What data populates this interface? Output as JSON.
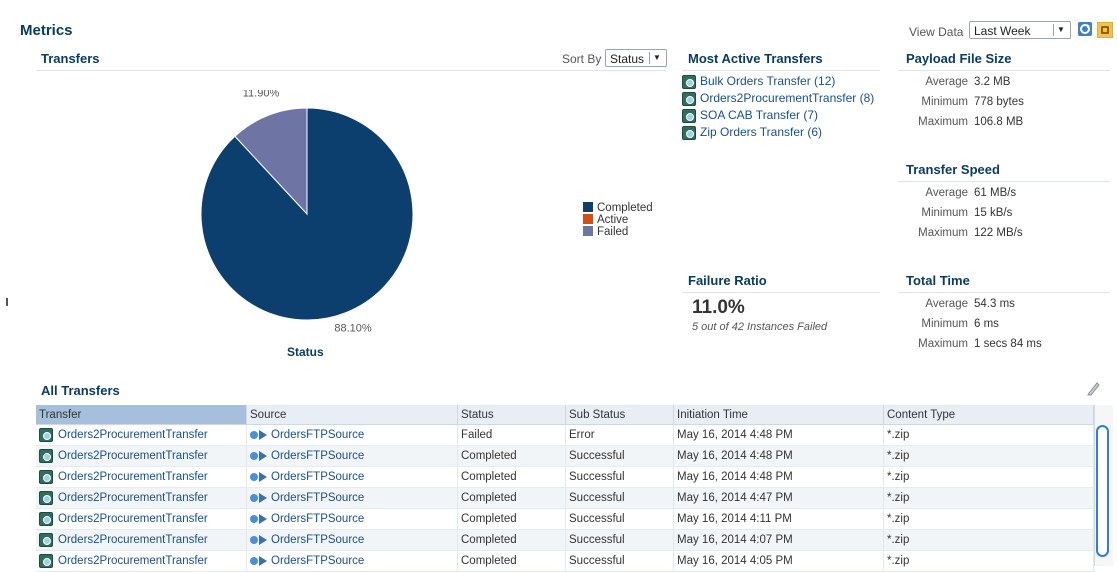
{
  "header": {
    "title": "Metrics",
    "view_data_label": "View Data",
    "view_data_value": "Last Week"
  },
  "transfers": {
    "title": "Transfers",
    "sort_by_label": "Sort By",
    "sort_by_value": "Status",
    "chart_data": {
      "type": "pie",
      "xlabel": "Status",
      "categories": [
        "Completed",
        "Active",
        "Failed"
      ],
      "values": [
        88.1,
        0,
        11.9
      ],
      "data_labels": [
        "88.10%",
        "",
        "11.90%"
      ],
      "legend_position": "right",
      "colors": [
        "#0d3f6e",
        "#d54e16",
        "#6e74a4"
      ]
    }
  },
  "most_active": {
    "title": "Most Active Transfers",
    "items": [
      "Bulk Orders Transfer (12)",
      "Orders2ProcurementTransfer (8)",
      "SOA CAB Transfer (7)",
      "Zip Orders Transfer (6)"
    ]
  },
  "payload": {
    "title": "Payload File Size",
    "rows": [
      {
        "k": "Average",
        "v": "3.2 MB"
      },
      {
        "k": "Minimum",
        "v": "778 bytes"
      },
      {
        "k": "Maximum",
        "v": "106.8 MB"
      }
    ]
  },
  "speed": {
    "title": "Transfer Speed",
    "rows": [
      {
        "k": "Average",
        "v": "61 MB/s"
      },
      {
        "k": "Minimum",
        "v": "15 kB/s"
      },
      {
        "k": "Maximum",
        "v": "122 MB/s"
      }
    ]
  },
  "failure": {
    "title": "Failure Ratio",
    "value": "11.0%",
    "caption": "5 out of 42 Instances Failed"
  },
  "total_time": {
    "title": "Total Time",
    "rows": [
      {
        "k": "Average",
        "v": "54.3 ms"
      },
      {
        "k": "Minimum",
        "v": "6 ms"
      },
      {
        "k": "Maximum",
        "v": "1 secs 84 ms"
      }
    ]
  },
  "all_transfers": {
    "title": "All Transfers",
    "columns": [
      "Transfer",
      "Source",
      "Status",
      "Sub Status",
      "Initiation Time",
      "Content Type"
    ],
    "rows": [
      [
        "Orders2ProcurementTransfer",
        "OrdersFTPSource",
        "Failed",
        "Error",
        "May 16, 2014 4:48 PM",
        "*.zip"
      ],
      [
        "Orders2ProcurementTransfer",
        "OrdersFTPSource",
        "Completed",
        "Successful",
        "May 16, 2014 4:48 PM",
        "*.zip"
      ],
      [
        "Orders2ProcurementTransfer",
        "OrdersFTPSource",
        "Completed",
        "Successful",
        "May 16, 2014 4:48 PM",
        "*.zip"
      ],
      [
        "Orders2ProcurementTransfer",
        "OrdersFTPSource",
        "Completed",
        "Successful",
        "May 16, 2014 4:47 PM",
        "*.zip"
      ],
      [
        "Orders2ProcurementTransfer",
        "OrdersFTPSource",
        "Completed",
        "Successful",
        "May 16, 2014 4:11 PM",
        "*.zip"
      ],
      [
        "Orders2ProcurementTransfer",
        "OrdersFTPSource",
        "Completed",
        "Successful",
        "May 16, 2014 4:07 PM",
        "*.zip"
      ],
      [
        "Orders2ProcurementTransfer",
        "OrdersFTPSource",
        "Completed",
        "Successful",
        "May 16, 2014 4:05 PM",
        "*.zip"
      ]
    ]
  },
  "icons": [
    "refresh-icon",
    "detach-icon",
    "edit-pencil-icon",
    "transfer-icon",
    "source-icon"
  ]
}
